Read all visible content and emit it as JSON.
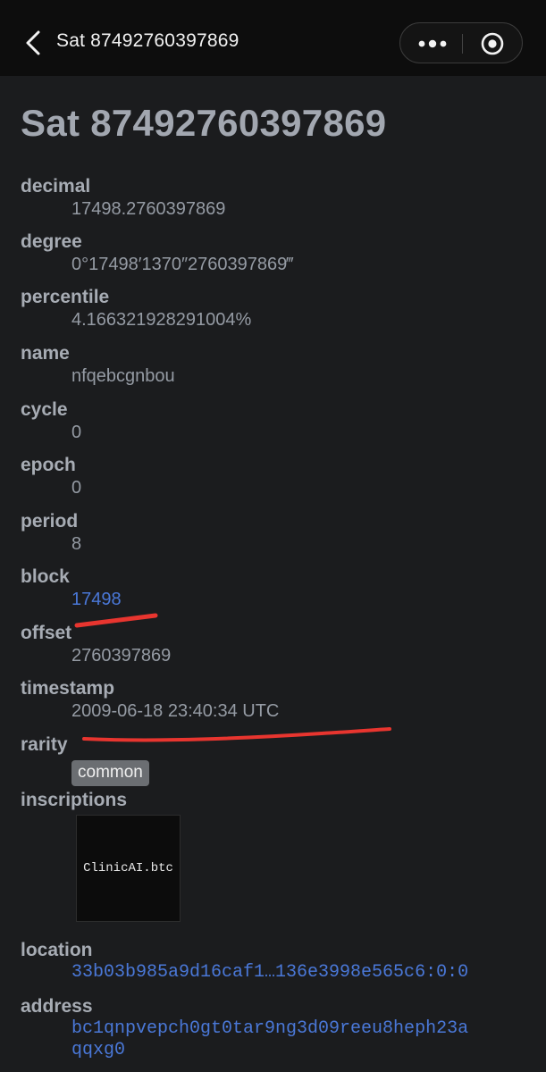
{
  "nav": {
    "title": "Sat 87492760397869"
  },
  "page": {
    "title": "Sat 87492760397869"
  },
  "fields": {
    "decimal": {
      "label": "decimal",
      "value": "17498.2760397869"
    },
    "degree": {
      "label": "degree",
      "value": "0°17498′1370″2760397869‴"
    },
    "percentile": {
      "label": "percentile",
      "value": "4.166321928291004%"
    },
    "name": {
      "label": "name",
      "value": "nfqebcgnbou"
    },
    "cycle": {
      "label": "cycle",
      "value": "0"
    },
    "epoch": {
      "label": "epoch",
      "value": "0"
    },
    "period": {
      "label": "period",
      "value": "8"
    },
    "block": {
      "label": "block",
      "value": "17498"
    },
    "offset": {
      "label": "offset",
      "value": "2760397869"
    },
    "timestamp": {
      "label": "timestamp",
      "value": "2009-06-18 23:40:34 UTC"
    },
    "rarity": {
      "label": "rarity",
      "value": "common"
    },
    "inscriptions": {
      "label": "inscriptions",
      "items": [
        {
          "text": "ClinicAI.btc"
        }
      ]
    },
    "location": {
      "label": "location",
      "value": "33b03b985a9d16caf1…136e3998e565c6:0:0"
    },
    "address": {
      "label": "address",
      "line1": "bc1qnpvepch0gt0tar9ng3d09reeu8heph23a",
      "line2": "qqxg0"
    }
  },
  "colors": {
    "background": "#1b1c1e",
    "topbar": "#0d0d0d",
    "link": "#4a78d8",
    "annotation": "#e8352f"
  }
}
